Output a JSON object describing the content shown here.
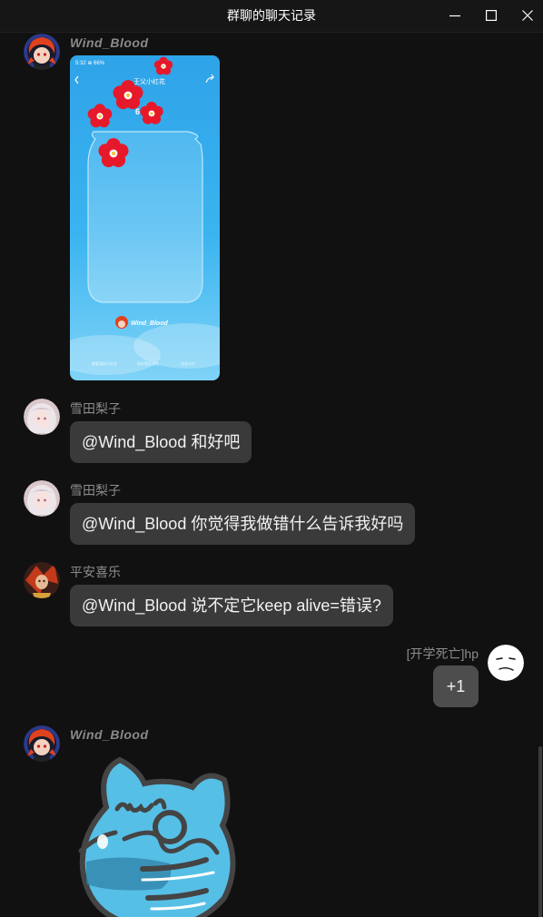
{
  "window": {
    "title": "群聊的聊天记录",
    "controls": [
      "minimize-icon",
      "maximize-icon",
      "close-icon"
    ]
  },
  "messages": [
    {
      "sender": "Wind_Blood",
      "type": "image",
      "avatar_icon": "anime-avatar-red-hair",
      "image": {
        "status_bar": "5:32  ⊕ 66%",
        "title": "王父小红花",
        "count_badge": "6",
        "watermark": "Wind_Blood",
        "footer": [
          "查看我的小红花",
          "给好朋友送花",
          "花语卡片"
        ]
      }
    },
    {
      "sender": "雪田梨子",
      "type": "text",
      "text": "@Wind_Blood 和好吧"
    },
    {
      "sender": "雪田梨子",
      "type": "text",
      "text": "@Wind_Blood 你觉得我做错什么告诉我好吗"
    },
    {
      "sender": "平安喜乐",
      "type": "text",
      "text": "@Wind_Blood 说不定它keep alive=错误?"
    },
    {
      "sender": "[开学死亡]hp",
      "type": "text",
      "text": "+1",
      "align": "right"
    },
    {
      "sender": "Wind_Blood",
      "type": "sticker",
      "sticker_icon": "blue-cat-face-sticker"
    }
  ],
  "colors": {
    "background": "#111111",
    "bubble": "#3a3a3a",
    "bubble_self": "#4d4d4d",
    "sky_top": "#2fa3e8",
    "flower": "#e6192a"
  }
}
